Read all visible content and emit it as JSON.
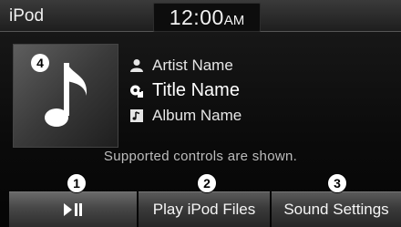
{
  "header": {
    "source": "iPod",
    "time": "12:00",
    "ampm": "AM"
  },
  "track": {
    "artist": "Artist Name",
    "title": "Title Name",
    "album": "Album Name"
  },
  "notice": "Supported controls are shown.",
  "buttons": {
    "play_pause_icon": "play-pause-icon",
    "play_files": "Play iPod Files",
    "sound_settings": "Sound Settings"
  },
  "callouts": [
    "1",
    "2",
    "3",
    "4"
  ],
  "icons": {
    "album_art": "music-note-icon",
    "artist": "person-icon",
    "title": "song-title-icon",
    "album": "album-icon"
  }
}
